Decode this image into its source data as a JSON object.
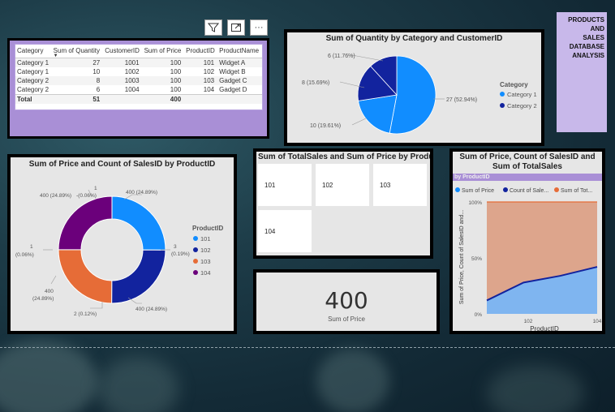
{
  "toolbar": {
    "filter_icon": "filter-icon",
    "focus_icon": "expand-icon",
    "more_label": "···"
  },
  "table": {
    "headers": [
      "Category",
      "Sum of Quantity",
      "CustomerID",
      "Sum of Price",
      "ProductID",
      "ProductName"
    ],
    "rows": [
      [
        "Category 1",
        "27",
        "1001",
        "100",
        "101",
        "Widget A"
      ],
      [
        "Category 1",
        "10",
        "1002",
        "100",
        "102",
        "Widget B"
      ],
      [
        "Category 2",
        "8",
        "1003",
        "100",
        "103",
        "Gadget C"
      ],
      [
        "Category 2",
        "6",
        "1004",
        "100",
        "104",
        "Gadget D"
      ]
    ],
    "total": [
      "Total",
      "51",
      "",
      "400",
      "",
      ""
    ]
  },
  "pie": {
    "title": "Sum of Quantity by Category and CustomerID",
    "legend_title": "Category",
    "legend": [
      {
        "name": "Category 1",
        "color": "#118DFF"
      },
      {
        "name": "Category 2",
        "color": "#12239E"
      }
    ],
    "labels": [
      "6 (11.76%)",
      "8 (15.69%)",
      "10 (19.61%)",
      "27 (52.94%)"
    ]
  },
  "title_box": {
    "text": "PRODUCTS AND SALES DATABASE ANALYSIS",
    "lines": [
      "PRODUCTS",
      "AND",
      "SALES",
      "DATABASE",
      "ANALYSIS"
    ]
  },
  "donut": {
    "title": "Sum of Price and Count of SalesID by ProductID",
    "legend_title": "ProductID",
    "legend": [
      {
        "name": "101",
        "color": "#118DFF"
      },
      {
        "name": "102",
        "color": "#12239E"
      },
      {
        "name": "103",
        "color": "#E66C37"
      },
      {
        "name": "104",
        "color": "#6B007B"
      }
    ],
    "labels": {
      "top_right": "400 (24.89%)",
      "right": "3",
      "right2": "(0.19%)",
      "bottom_right": "400 (24.89%)",
      "bottom": "2 (0.12%)",
      "left_bottom": "400",
      "left_bottom2": "(24.89%)",
      "left": "1",
      "left2": "(0.06%)",
      "top_left": "400 (24.89%)",
      "top_left_small": "-(0.06%)",
      "top_one": "1"
    }
  },
  "tiles": {
    "title": "Sum of TotalSales and Sum of Price by ProductID",
    "items": [
      "101",
      "102",
      "103",
      "104"
    ]
  },
  "card": {
    "value": "400",
    "label": "Sum of Price"
  },
  "area": {
    "title": "Sum of Price, Count of SalesID and Sum of TotalSales",
    "subtitle": "by ProductID",
    "legend": [
      {
        "name": "Sum of Price",
        "color": "#118DFF"
      },
      {
        "name": "Count of Sale...",
        "color": "#12239E"
      },
      {
        "name": "Sum of Tot...",
        "color": "#E66C37"
      }
    ],
    "y_ticks": [
      "100%",
      "50%",
      "0%"
    ],
    "x_ticks": [
      "102",
      "104"
    ],
    "ylabel": "Sum of Price, Count of SalesID and...",
    "xlabel": "ProductID"
  },
  "chart_data": [
    {
      "type": "pie",
      "title": "Sum of Quantity by Category and CustomerID",
      "categories": [
        "Category 1 / 1001",
        "Category 1 / 1002",
        "Category 2 / 1003",
        "Category 2 / 1004"
      ],
      "values": [
        27,
        10,
        8,
        6
      ],
      "percents": [
        52.94,
        19.61,
        15.69,
        11.76
      ],
      "legend_placement": "right"
    },
    {
      "type": "pie",
      "title": "Sum of Price and Count of SalesID by ProductID",
      "categories": [
        "101",
        "102",
        "103",
        "104"
      ],
      "series": [
        {
          "name": "Sum of Price",
          "values": [
            400,
            400,
            400,
            400
          ]
        },
        {
          "name": "Count of SalesID",
          "values": [
            3,
            2,
            1,
            1
          ]
        }
      ],
      "legend_placement": "right"
    },
    {
      "type": "area",
      "title": "Sum of Price, Count of SalesID and Sum of TotalSales",
      "x": [
        "101",
        "102",
        "103",
        "104"
      ],
      "series": [
        {
          "name": "Sum of Price",
          "values": [
            12,
            28,
            34,
            42
          ]
        },
        {
          "name": "Count of SalesID",
          "values": [
            0.3,
            0.2,
            0.1,
            0.1
          ]
        },
        {
          "name": "Sum of TotalSales",
          "values": [
            87.7,
            71.8,
            65.9,
            57.9
          ]
        }
      ],
      "ylim": [
        0,
        100
      ],
      "xlabel": "ProductID",
      "ylabel": "Sum of Price, Count of SalesID and...",
      "legend_placement": "top"
    }
  ]
}
